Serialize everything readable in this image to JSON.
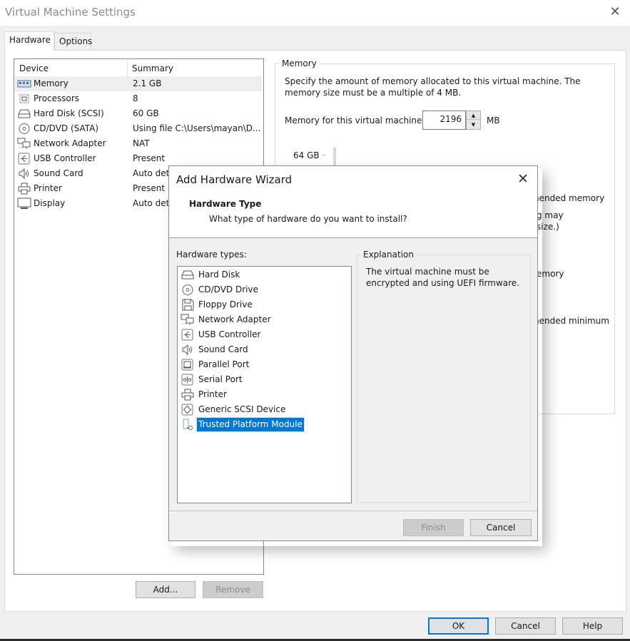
{
  "window": {
    "title": "Virtual Machine Settings",
    "close_icon": "close-icon"
  },
  "tabs": [
    {
      "label": "Hardware",
      "active": true
    },
    {
      "label": "Options",
      "active": false
    }
  ],
  "device_list": {
    "columns": [
      "Device",
      "Summary"
    ],
    "rows": [
      {
        "icon": "memory-icon",
        "device": "Memory",
        "summary": "2.1 GB",
        "selected": true
      },
      {
        "icon": "processor-icon",
        "device": "Processors",
        "summary": "8"
      },
      {
        "icon": "hard-disk-icon",
        "device": "Hard Disk (SCSI)",
        "summary": "60 GB"
      },
      {
        "icon": "cd-dvd-icon",
        "device": "CD/DVD (SATA)",
        "summary": "Using file C:\\Users\\mayan\\D..."
      },
      {
        "icon": "network-adapter-icon",
        "device": "Network Adapter",
        "summary": "NAT"
      },
      {
        "icon": "usb-icon",
        "device": "USB Controller",
        "summary": "Present"
      },
      {
        "icon": "sound-icon",
        "device": "Sound Card",
        "summary": "Auto dete"
      },
      {
        "icon": "printer-icon",
        "device": "Printer",
        "summary": "Present"
      },
      {
        "icon": "display-icon",
        "device": "Display",
        "summary": "Auto dete"
      }
    ],
    "add_button": "Add...",
    "remove_button": "Remove"
  },
  "memory": {
    "group_label": "Memory",
    "description": "Specify the amount of memory allocated to this virtual machine. The memory size must be a multiple of 4 MB.",
    "field_label": "Memory for this virtual machine:",
    "value": "2196",
    "unit": "MB",
    "scale_max_label": "64 GB",
    "obscured_fragments": [
      "nended memory",
      "g may",
      " size.)",
      "emory",
      "nended minimum"
    ]
  },
  "footer": {
    "ok": "OK",
    "cancel": "Cancel",
    "help": "Help"
  },
  "wizard": {
    "title": "Add Hardware Wizard",
    "heading": "Hardware Type",
    "subheading": "What type of hardware do you want to install?",
    "types_label": "Hardware types:",
    "types": [
      {
        "icon": "hard-disk-icon",
        "label": "Hard Disk"
      },
      {
        "icon": "cd-dvd-icon",
        "label": "CD/DVD Drive"
      },
      {
        "icon": "floppy-icon",
        "label": "Floppy Drive"
      },
      {
        "icon": "network-adapter-icon",
        "label": "Network Adapter"
      },
      {
        "icon": "usb-icon",
        "label": "USB Controller"
      },
      {
        "icon": "sound-icon",
        "label": "Sound Card"
      },
      {
        "icon": "parallel-port-icon",
        "label": "Parallel Port"
      },
      {
        "icon": "serial-port-icon",
        "label": "Serial Port"
      },
      {
        "icon": "printer-icon",
        "label": "Printer"
      },
      {
        "icon": "scsi-device-icon",
        "label": "Generic SCSI Device"
      },
      {
        "icon": "tpm-icon",
        "label": "Trusted Platform Module",
        "selected": true
      }
    ],
    "explanation_label": "Explanation",
    "explanation": "The virtual machine must be encrypted and using UEFI firmware.",
    "finish_button": "Finish",
    "cancel_button": "Cancel"
  },
  "colors": {
    "accent": "#0078d7",
    "selection_bg": "#0078d7",
    "disabled_button": "#cccccc"
  }
}
